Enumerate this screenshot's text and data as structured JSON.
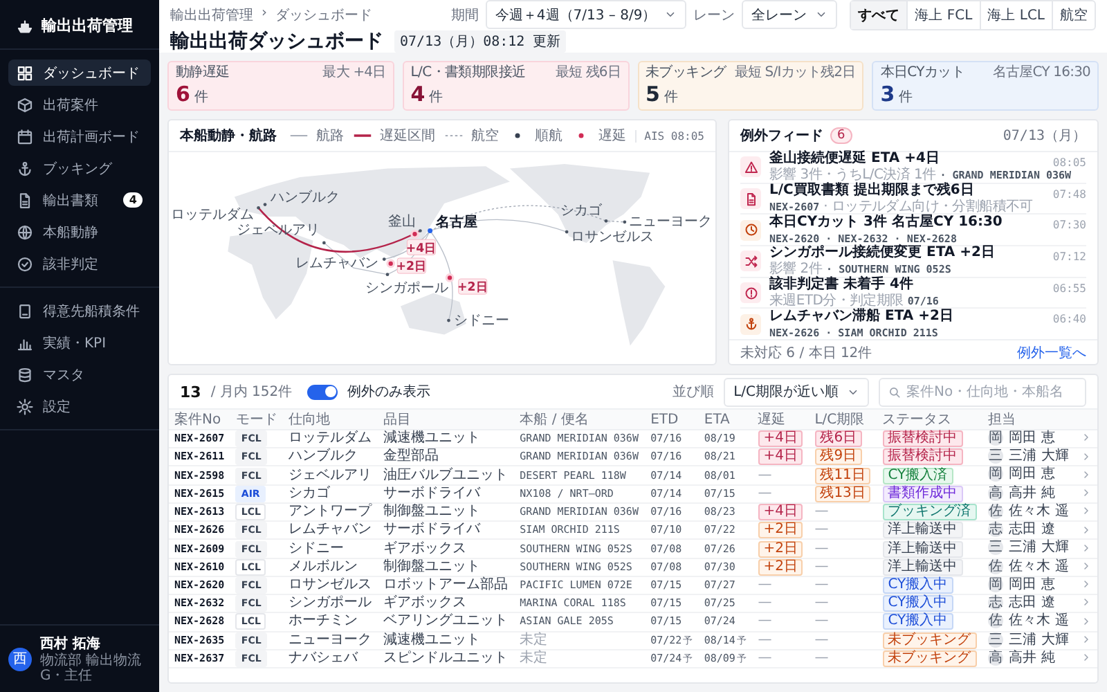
{
  "sidebar": {
    "brand": "輸出出荷管理",
    "groups": [
      {
        "items": [
          {
            "label": "ダッシュボード",
            "kind": "grid",
            "selected": true
          },
          {
            "label": "出荷案件",
            "kind": "box",
            "selected": false
          },
          {
            "label": "出荷計画ボード",
            "kind": "calendar",
            "selected": false
          },
          {
            "label": "ブッキング",
            "kind": "anchor",
            "selected": false
          },
          {
            "label": "輸出書類",
            "kind": "document",
            "selected": false,
            "badge": "4"
          },
          {
            "label": "本船動静",
            "kind": "globe",
            "selected": false
          },
          {
            "label": "該非判定",
            "kind": "check",
            "selected": false
          }
        ]
      },
      {
        "items": [
          {
            "label": "得意先船積条件",
            "kind": "book",
            "selected": false
          },
          {
            "label": "実績・KPI",
            "kind": "chart",
            "selected": false
          },
          {
            "label": "マスタ",
            "kind": "database",
            "selected": false
          },
          {
            "label": "設定",
            "kind": "gear",
            "selected": false
          }
        ]
      }
    ],
    "user": {
      "initial": "西",
      "name": "西村 拓海",
      "role": "物流部 輸出物流G・主任"
    }
  },
  "header": {
    "breadcrumb": [
      "輸出出荷管理",
      "ダッシュボード"
    ],
    "separator": "›",
    "title": "輸出出荷ダッシュボード",
    "updated": "07/13（月）08:12 更新",
    "filters": [
      {
        "label": "期間",
        "value": "今週＋4週（7/13 – 8/9）"
      },
      {
        "label": "レーン",
        "value": "全レーン"
      }
    ],
    "segments": [
      {
        "label": "すべて",
        "selected": true
      },
      {
        "label": "海上 FCL",
        "selected": false
      },
      {
        "label": "海上 LCL",
        "selected": false
      },
      {
        "label": "航空",
        "selected": false
      }
    ]
  },
  "kpis": [
    {
      "kind": "delay",
      "title": "動静遅延",
      "note": "最大 +4日",
      "value": "6",
      "unit": "件"
    },
    {
      "kind": "deadline",
      "title": "L/C・書類期限接近",
      "note": "最短 残6日",
      "value": "4",
      "unit": "件"
    },
    {
      "kind": "booking",
      "title": "未ブッキング",
      "note": "最短 S/Iカット残2日",
      "value": "5",
      "unit": "件"
    },
    {
      "kind": "cutoff",
      "title": "本日CYカット",
      "note": "名古屋CY 16:30",
      "value": "3",
      "unit": "件"
    }
  ],
  "map": {
    "title": "本船動静・航路",
    "ais": "AIS 08:05",
    "legend": [
      {
        "kind": "route",
        "label": "航路"
      },
      {
        "kind": "delay-route",
        "label": "遅延区間"
      },
      {
        "kind": "air",
        "label": "航空"
      },
      {
        "kind": "on-time",
        "label": "順航"
      },
      {
        "kind": "delayed",
        "label": "遅延"
      }
    ],
    "ports": [
      {
        "name": "ハンブルク",
        "kind": "port"
      },
      {
        "name": "ロッテルダム",
        "kind": "port"
      },
      {
        "name": "釜山",
        "kind": "port"
      },
      {
        "name": "名古屋",
        "kind": "hub"
      },
      {
        "name": "シカゴ",
        "kind": "port"
      },
      {
        "name": "ニューヨーク",
        "kind": "port"
      },
      {
        "name": "ロサンゼルス",
        "kind": "port"
      },
      {
        "name": "ジェベルアリ",
        "kind": "port"
      },
      {
        "name": "レムチャバン",
        "kind": "port"
      },
      {
        "name": "シンガポール",
        "kind": "port"
      },
      {
        "name": "シドニー",
        "kind": "port"
      }
    ],
    "delays": [
      {
        "label": "+4日"
      },
      {
        "label": "+2日"
      },
      {
        "label": "+2日"
      }
    ]
  },
  "feed": {
    "title": "例外フィード",
    "count": "6",
    "date": "07/13（月）",
    "items": [
      {
        "kind": "warning",
        "title": "釜山接続便遅延 ETA +4日",
        "time": "08:05",
        "parts": [
          {
            "kind": "note",
            "text": "影響 3件・うちL/C決済 1件"
          },
          {
            "kind": "ref",
            "text": "· GRAND MERIDIAN 036W"
          }
        ]
      },
      {
        "kind": "document",
        "title": "L/C買取書類 提出期限まで残6日",
        "time": "07:48",
        "parts": [
          {
            "kind": "ref",
            "text": "NEX-2607"
          },
          {
            "kind": "note",
            "text": "· ロッテルダム向け・分割船積不可"
          }
        ]
      },
      {
        "kind": "clock",
        "title": "本日CYカット 3件 名古屋CY 16:30",
        "time": "07:30",
        "parts": [
          {
            "kind": "ref",
            "text": "NEX-2620 · NEX-2632 · NEX-2628"
          }
        ]
      },
      {
        "kind": "transfer",
        "title": "シンガポール接続便変更 ETA +2日",
        "time": "07:12",
        "parts": [
          {
            "kind": "note",
            "text": "影響 2件"
          },
          {
            "kind": "ref",
            "text": "· SOUTHERN WING 052S"
          }
        ]
      },
      {
        "kind": "alert",
        "title": "該非判定書 未着手 4件",
        "time": "06:55",
        "parts": [
          {
            "kind": "note",
            "text": "来週ETD分・判定期限"
          },
          {
            "kind": "ref",
            "text": "07/16"
          }
        ]
      },
      {
        "kind": "anchor",
        "title": "レムチャバン滞船 ETA +2日",
        "time": "06:40",
        "parts": [
          {
            "kind": "ref",
            "text": "NEX-2626 · SIAM ORCHID 211S"
          }
        ]
      }
    ],
    "footer": "未対応 6 / 本日 12件",
    "link": "例外一覧へ"
  },
  "table": {
    "count": "13",
    "total": "/ 月内 152件",
    "toggle": {
      "label": "例外のみ表示",
      "on": true
    },
    "sort_label": "並び順",
    "sort": "L/C期限が近い順",
    "search": {
      "placeholder": "案件No・仕向地・本船名"
    },
    "columns": [
      "案件No",
      "モード",
      "仕向地",
      "品目",
      "本船 / 便名",
      "ETD",
      "ETA",
      "遅延",
      "L/C期限",
      "ステータス",
      "担当"
    ],
    "rows": [
      {
        "no": "NEX-2607",
        "mode": "FCL",
        "dest": "ロッテルダム",
        "item": "減速機ユニット",
        "vessel": "GRAND MERIDIAN 036W",
        "etd": "07/16",
        "eta": "08/19",
        "delay": {
          "text": "+4日",
          "kind": "major"
        },
        "lc": {
          "text": "残6日",
          "kind": "urgent"
        },
        "status": {
          "text": "振替検討中",
          "kind": "red"
        },
        "assignee": {
          "initial": "岡",
          "name": "岡田 恵"
        }
      },
      {
        "no": "NEX-2611",
        "mode": "FCL",
        "dest": "ハンブルク",
        "item": "金型部品",
        "vessel": "GRAND MERIDIAN 036W",
        "etd": "07/16",
        "eta": "08/21",
        "delay": {
          "text": "+4日",
          "kind": "major"
        },
        "lc": {
          "text": "残9日",
          "kind": "warn"
        },
        "status": {
          "text": "振替検討中",
          "kind": "red"
        },
        "assignee": {
          "initial": "三",
          "name": "三浦 大輝"
        }
      },
      {
        "no": "NEX-2598",
        "mode": "FCL",
        "dest": "ジェベルアリ",
        "item": "油圧バルブユニット",
        "vessel": "DESERT PEARL 118W",
        "etd": "07/14",
        "eta": "08/01",
        "delay": {
          "text": "—",
          "kind": "none"
        },
        "lc": {
          "text": "残11日",
          "kind": "warn"
        },
        "status": {
          "text": "CY搬入済",
          "kind": "green"
        },
        "assignee": {
          "initial": "岡",
          "name": "岡田 恵"
        }
      },
      {
        "no": "NEX-2615",
        "mode": "AIR",
        "dest": "シカゴ",
        "item": "サーボドライバ",
        "vessel": "NX108 / NRT–ORD",
        "etd": "07/14",
        "eta": "07/15",
        "delay": {
          "text": "—",
          "kind": "none"
        },
        "lc": {
          "text": "残13日",
          "kind": "warn"
        },
        "status": {
          "text": "書類作成中",
          "kind": "purple"
        },
        "assignee": {
          "initial": "高",
          "name": "高井 純"
        }
      },
      {
        "no": "NEX-2613",
        "mode": "LCL",
        "dest": "アントワープ",
        "item": "制御盤ユニット",
        "vessel": "GRAND MERIDIAN 036W",
        "etd": "07/16",
        "eta": "08/23",
        "delay": {
          "text": "+4日",
          "kind": "major"
        },
        "lc": {
          "text": "—",
          "kind": "none"
        },
        "status": {
          "text": "ブッキング済",
          "kind": "teal"
        },
        "assignee": {
          "initial": "佐",
          "name": "佐々木 遥"
        }
      },
      {
        "no": "NEX-2626",
        "mode": "FCL",
        "dest": "レムチャバン",
        "item": "サーボドライバ",
        "vessel": "SIAM ORCHID 211S",
        "etd": "07/10",
        "eta": "07/22",
        "delay": {
          "text": "+2日",
          "kind": "minor"
        },
        "lc": {
          "text": "—",
          "kind": "none"
        },
        "status": {
          "text": "洋上輸送中",
          "kind": "grey"
        },
        "assignee": {
          "initial": "志",
          "name": "志田 遼"
        }
      },
      {
        "no": "NEX-2609",
        "mode": "FCL",
        "dest": "シドニー",
        "item": "ギアボックス",
        "vessel": "SOUTHERN WING 052S",
        "etd": "07/08",
        "eta": "07/26",
        "delay": {
          "text": "+2日",
          "kind": "minor"
        },
        "lc": {
          "text": "—",
          "kind": "none"
        },
        "status": {
          "text": "洋上輸送中",
          "kind": "grey"
        },
        "assignee": {
          "initial": "三",
          "name": "三浦 大輝"
        }
      },
      {
        "no": "NEX-2610",
        "mode": "LCL",
        "dest": "メルボルン",
        "item": "制御盤ユニット",
        "vessel": "SOUTHERN WING 052S",
        "etd": "07/08",
        "eta": "07/30",
        "delay": {
          "text": "+2日",
          "kind": "minor"
        },
        "lc": {
          "text": "—",
          "kind": "none"
        },
        "status": {
          "text": "洋上輸送中",
          "kind": "grey"
        },
        "assignee": {
          "initial": "佐",
          "name": "佐々木 遥"
        }
      },
      {
        "no": "NEX-2620",
        "mode": "FCL",
        "dest": "ロサンゼルス",
        "item": "ロボットアーム部品",
        "vessel": "PACIFIC LUMEN 072E",
        "etd": "07/15",
        "eta": "07/27",
        "delay": {
          "text": "—",
          "kind": "none"
        },
        "lc": {
          "text": "—",
          "kind": "none"
        },
        "status": {
          "text": "CY搬入中",
          "kind": "blue"
        },
        "assignee": {
          "initial": "岡",
          "name": "岡田 恵"
        }
      },
      {
        "no": "NEX-2632",
        "mode": "FCL",
        "dest": "シンガポール",
        "item": "ギアボックス",
        "vessel": "MARINA CORAL 118S",
        "etd": "07/15",
        "eta": "07/25",
        "delay": {
          "text": "—",
          "kind": "none"
        },
        "lc": {
          "text": "—",
          "kind": "none"
        },
        "status": {
          "text": "CY搬入中",
          "kind": "blue"
        },
        "assignee": {
          "initial": "志",
          "name": "志田 遼"
        }
      },
      {
        "no": "NEX-2628",
        "mode": "LCL",
        "dest": "ホーチミン",
        "item": "ベアリングユニット",
        "vessel": "ASIAN GALE 205S",
        "etd": "07/15",
        "eta": "07/24",
        "delay": {
          "text": "—",
          "kind": "none"
        },
        "lc": {
          "text": "—",
          "kind": "none"
        },
        "status": {
          "text": "CY搬入中",
          "kind": "blue"
        },
        "assignee": {
          "initial": "佐",
          "name": "佐々木 遥"
        }
      },
      {
        "no": "NEX-2635",
        "mode": "FCL",
        "dest": "ニューヨーク",
        "item": "減速機ユニット",
        "vessel": "未定",
        "vessel_pending": true,
        "etd": "07/22",
        "etd_note": "予",
        "eta": "08/14",
        "eta_note": "予",
        "delay": {
          "text": "—",
          "kind": "none"
        },
        "lc": {
          "text": "—",
          "kind": "none"
        },
        "status": {
          "text": "未ブッキング",
          "kind": "orange"
        },
        "assignee": {
          "initial": "三",
          "name": "三浦 大輝"
        }
      },
      {
        "no": "NEX-2637",
        "mode": "FCL",
        "dest": "ナバシェバ",
        "item": "スピンドルユニット",
        "vessel": "未定",
        "vessel_pending": true,
        "etd": "07/24",
        "etd_note": "予",
        "eta": "08/09",
        "eta_note": "予",
        "delay": {
          "text": "—",
          "kind": "none"
        },
        "lc": {
          "text": "—",
          "kind": "none"
        },
        "status": {
          "text": "未ブッキング",
          "kind": "orange"
        },
        "assignee": {
          "initial": "高",
          "name": "高井 純"
        }
      }
    ]
  }
}
